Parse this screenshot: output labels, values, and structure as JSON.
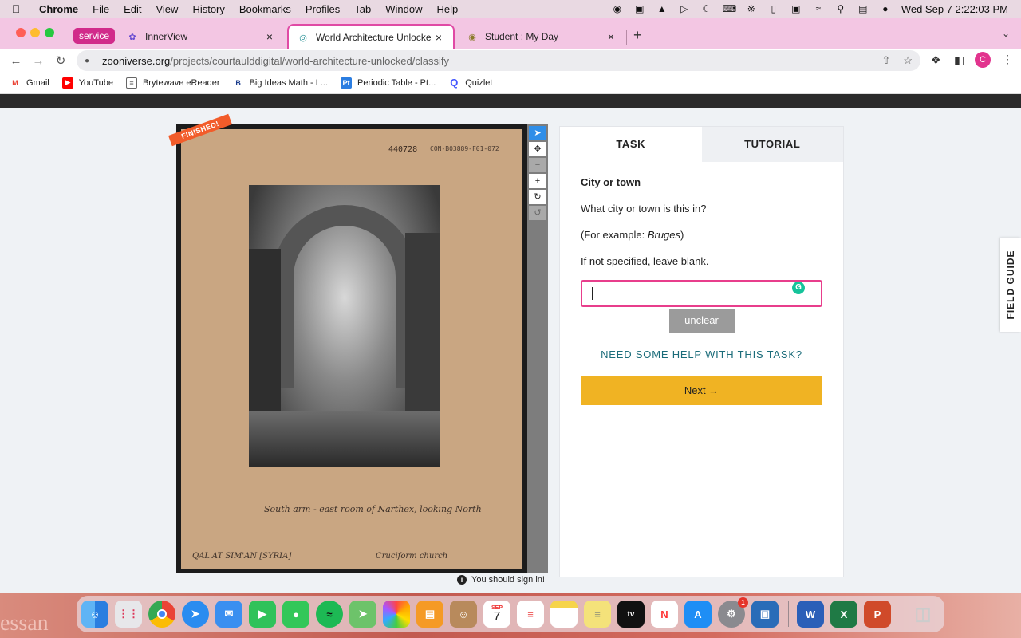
{
  "menubar": {
    "app": "Chrome",
    "items": [
      "File",
      "Edit",
      "View",
      "History",
      "Bookmarks",
      "Profiles",
      "Tab",
      "Window",
      "Help"
    ],
    "clock": "Wed Sep 7  2:22:03 PM"
  },
  "tabs": {
    "group_label": "service",
    "items": [
      {
        "title": "InnerView"
      },
      {
        "title": "World Architecture Unlocked"
      },
      {
        "title": "Student : My Day"
      }
    ]
  },
  "address": {
    "host": "zooniverse.org",
    "path": "/projects/courtaulddigital/world-architecture-unlocked/classify"
  },
  "bookmarks": [
    {
      "label": "Gmail",
      "icon": "gmail-icon",
      "color": "#ea4335"
    },
    {
      "label": "YouTube",
      "icon": "youtube-icon",
      "color": "#ff0000"
    },
    {
      "label": "Brytewave eReader",
      "icon": "document-icon",
      "color": "#666666"
    },
    {
      "label": "Big Ideas Math - L...",
      "icon": "b-icon",
      "color": "#1a3c8c"
    },
    {
      "label": "Periodic Table - Pt...",
      "icon": "pt-icon",
      "color": "#2a7de1"
    },
    {
      "label": "Quizlet",
      "icon": "quizlet-icon",
      "color": "#4255ff"
    }
  ],
  "viewer": {
    "badge": "FINISHED!",
    "sheet_number": "440728",
    "sheet_code": "CON-B03889-F01-072",
    "caption_1": "South arm - east room of Narthex, looking North",
    "caption_2": "QAL'AT SIM'AN [SYRIA]",
    "caption_3": "Cruciform church",
    "signin_notice": "You should sign in!"
  },
  "task_panel": {
    "tab_task": "TASK",
    "tab_tutorial": "TUTORIAL",
    "question_title": "City or town",
    "question": "What city or town is this in?",
    "example_prefix": "(For example: ",
    "example_value": "Bruges",
    "example_suffix": ")",
    "instruction": "If not specified, leave blank.",
    "answer_value": "",
    "unclear_label": "unclear",
    "help_link": "NEED SOME HELP WITH THIS TASK?",
    "next_label": "Next →"
  },
  "field_guide_label": "FIELD GUIDE",
  "desktop_text": "essan",
  "dock": {
    "calendar_month": "SEP",
    "calendar_day": "7",
    "settings_badge": "1"
  },
  "colors": {
    "accent_pink": "#e83e8c",
    "next_yellow": "#f0b323",
    "help_teal": "#1b6c7a",
    "finished_orange": "#f25c2a",
    "tool_active_blue": "#2f8ee8"
  }
}
